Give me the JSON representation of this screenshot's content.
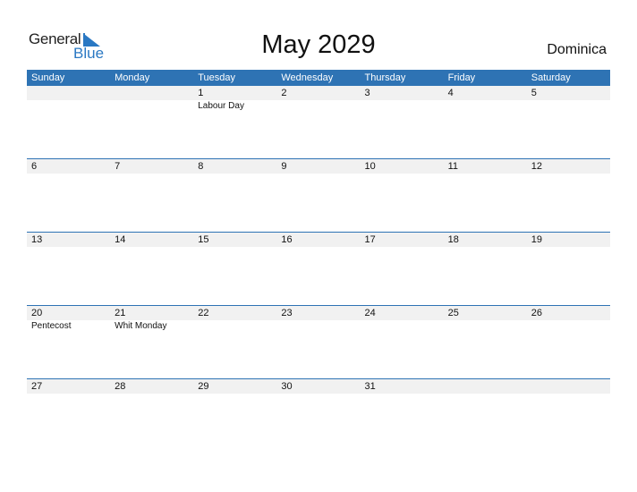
{
  "logo": {
    "general": "General",
    "blue": "Blue"
  },
  "title": "May 2029",
  "country": "Dominica",
  "colors": {
    "accent": "#2e73b4",
    "row_bg": "#f1f1f1"
  },
  "weekdays": [
    "Sunday",
    "Monday",
    "Tuesday",
    "Wednesday",
    "Thursday",
    "Friday",
    "Saturday"
  ],
  "weeks": [
    {
      "days": [
        "",
        "",
        "1",
        "2",
        "3",
        "4",
        "5"
      ],
      "events": [
        "",
        "",
        "Labour Day",
        "",
        "",
        "",
        ""
      ]
    },
    {
      "days": [
        "6",
        "7",
        "8",
        "9",
        "10",
        "11",
        "12"
      ],
      "events": [
        "",
        "",
        "",
        "",
        "",
        "",
        ""
      ]
    },
    {
      "days": [
        "13",
        "14",
        "15",
        "16",
        "17",
        "18",
        "19"
      ],
      "events": [
        "",
        "",
        "",
        "",
        "",
        "",
        ""
      ]
    },
    {
      "days": [
        "20",
        "21",
        "22",
        "23",
        "24",
        "25",
        "26"
      ],
      "events": [
        "Pentecost",
        "Whit Monday",
        "",
        "",
        "",
        "",
        ""
      ]
    },
    {
      "days": [
        "27",
        "28",
        "29",
        "30",
        "31",
        "",
        ""
      ],
      "events": [
        "",
        "",
        "",
        "",
        "",
        "",
        ""
      ]
    }
  ]
}
